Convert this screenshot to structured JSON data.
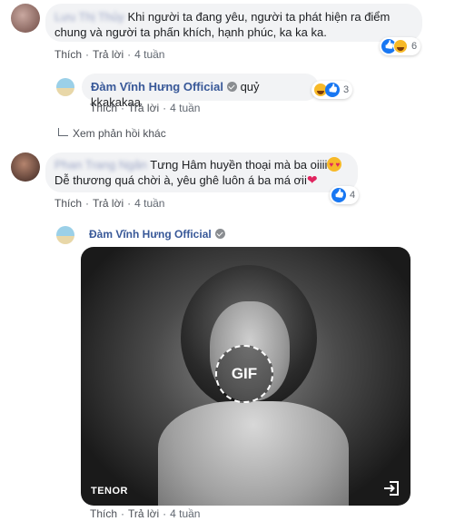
{
  "comments": [
    {
      "author": "Lưu Thị Thủy",
      "text": "Khi người ta đang yêu, người ta phát hiện ra điểm chung và người ta phấn khích, hạnh phúc, ka ka ka.",
      "reaction_count": "6",
      "actions": {
        "like": "Thích",
        "reply": "Trả lời",
        "time": "4 tuần"
      },
      "reply": {
        "author": "Đàm Vĩnh Hưng Official",
        "text": "quỷ kkakakaa",
        "reaction_count": "3",
        "actions": {
          "like": "Thích",
          "reply": "Trả lời",
          "time": "4 tuần"
        }
      },
      "more_replies": "Xem phản hồi khác"
    },
    {
      "author": "Phan Trang Ngân",
      "text_line1": "Tưng Hâm huyền thoại mà ba oiiii",
      "text_line2": "Dễ thương quá chời à, yêu ghê luôn á ba má ơii",
      "reaction_count": "4",
      "actions": {
        "like": "Thích",
        "reply": "Trả lời",
        "time": "4 tuần"
      },
      "reply": {
        "author": "Đàm Vĩnh Hưng Official",
        "gif_label": "GIF",
        "gif_provider": "TENOR",
        "actions": {
          "like": "Thích",
          "reply": "Trả lời",
          "time": "4 tuần"
        }
      }
    }
  ],
  "colors": {
    "link": "#385898",
    "bubble": "#f2f3f5",
    "like_blue": "#1877f2",
    "haha_yellow": "#f7b928"
  }
}
